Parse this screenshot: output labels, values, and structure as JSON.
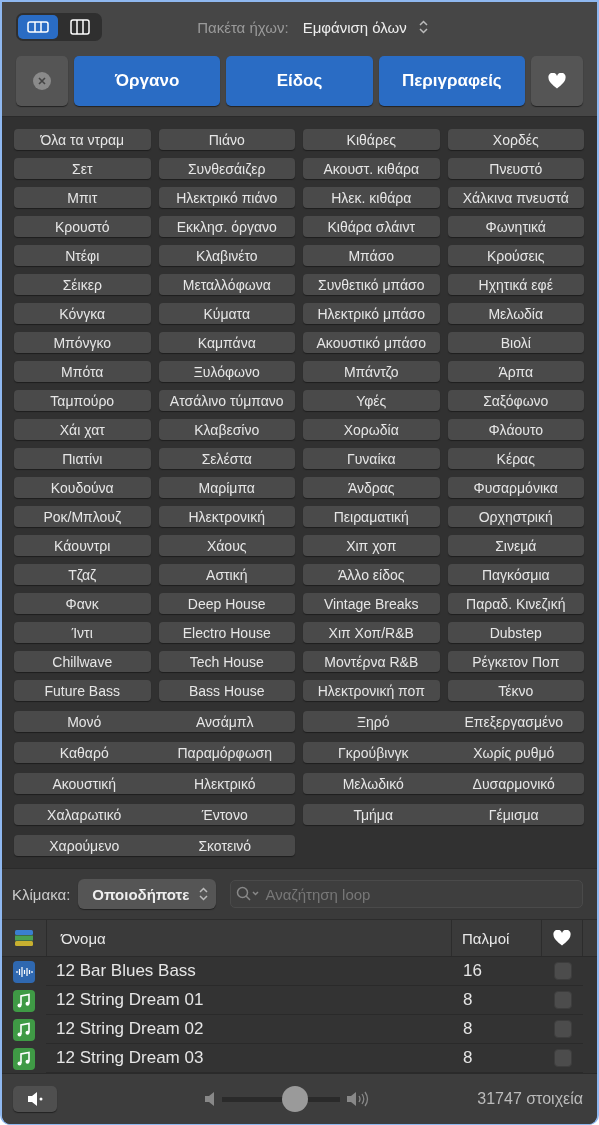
{
  "toolbar": {
    "view_modes": [
      {
        "kind": "rows",
        "selected": true
      },
      {
        "kind": "columns",
        "selected": false
      }
    ],
    "label": "Πακέτα ήχων:",
    "value": "Εμφάνιση όλων"
  },
  "categories": [
    {
      "label": "Όργανο",
      "selected": true
    },
    {
      "label": "Είδος",
      "selected": true
    },
    {
      "label": "Περιγραφείς",
      "selected": true
    }
  ],
  "keywords": [
    [
      {
        "label": "Όλα τα ντραμ",
        "selected": false
      },
      {
        "label": "Πιάνο",
        "selected": false
      },
      {
        "label": "Κιθάρες",
        "selected": false
      },
      {
        "label": "Χορδές",
        "selected": false
      }
    ],
    [
      {
        "label": "Σετ",
        "selected": false
      },
      {
        "label": "Συνθεσάιζερ",
        "selected": false
      },
      {
        "label": "Ακουστ. κιθάρα",
        "selected": false
      },
      {
        "label": "Πνευστό",
        "selected": false
      }
    ],
    [
      {
        "label": "Μπιτ",
        "selected": false
      },
      {
        "label": "Ηλεκτρικό πιάνο",
        "selected": false
      },
      {
        "label": "Ηλεκ. κιθάρα",
        "selected": false
      },
      {
        "label": "Χάλκινα πνευστά",
        "selected": false
      }
    ],
    [
      {
        "label": "Κρουστό",
        "selected": false
      },
      {
        "label": "Εκκλησ. όργανο",
        "selected": false
      },
      {
        "label": "Κιθάρα σλάιντ",
        "selected": false
      },
      {
        "label": "Φωνητικά",
        "selected": false
      }
    ],
    [
      {
        "label": "Ντέφι",
        "selected": false
      },
      {
        "label": "Κλαβινέτο",
        "selected": false
      },
      {
        "label": "Μπάσο",
        "selected": false
      },
      {
        "label": "Κρούσεις",
        "selected": false
      }
    ],
    [
      {
        "label": "Σέικερ",
        "selected": false
      },
      {
        "label": "Μεταλλόφωνα",
        "selected": false
      },
      {
        "label": "Συνθετικό μπάσο",
        "selected": false
      },
      {
        "label": "Ηχητικά εφέ",
        "selected": false
      }
    ],
    [
      {
        "label": "Κόνγκα",
        "selected": false
      },
      {
        "label": "Κύματα",
        "selected": false
      },
      {
        "label": "Ηλεκτρικό μπάσο",
        "selected": false
      },
      {
        "label": "Μελωδία",
        "selected": false
      }
    ],
    [
      {
        "label": "Μπόνγκο",
        "selected": false
      },
      {
        "label": "Καμπάνα",
        "selected": false
      },
      {
        "label": "Ακουστικό μπάσο",
        "selected": false
      },
      {
        "label": "Βιολί",
        "selected": false
      }
    ],
    [
      {
        "label": "Μπότα",
        "selected": false
      },
      {
        "label": "Ξυλόφωνο",
        "selected": false
      },
      {
        "label": "Μπάντζο",
        "selected": false
      },
      {
        "label": "Άρπα",
        "selected": false
      }
    ],
    [
      {
        "label": "Ταμπούρο",
        "selected": false
      },
      {
        "label": "Ατσάλινο τύμπανο",
        "selected": false
      },
      {
        "label": "Υφές",
        "selected": false
      },
      {
        "label": "Σαξόφωνο",
        "selected": false
      }
    ],
    [
      {
        "label": "Χάι χατ",
        "selected": false
      },
      {
        "label": "Κλαβεσίνο",
        "selected": false
      },
      {
        "label": "Χορωδία",
        "selected": false
      },
      {
        "label": "Φλάουτο",
        "selected": false
      }
    ],
    [
      {
        "label": "Πιατίνι",
        "selected": false
      },
      {
        "label": "Σελέστα",
        "selected": false
      },
      {
        "label": "Γυναίκα",
        "selected": false
      },
      {
        "label": "Κέρας",
        "selected": false
      }
    ],
    [
      {
        "label": "Κουδούνα",
        "selected": false
      },
      {
        "label": "Μαρίμπα",
        "selected": false
      },
      {
        "label": "Άνδρας",
        "selected": false
      },
      {
        "label": "Φυσαρμόνικα",
        "selected": false
      }
    ],
    [
      {
        "label": "Ροκ/Μπλουζ",
        "selected": false
      },
      {
        "label": "Ηλεκτρονική",
        "selected": false
      },
      {
        "label": "Πειραματική",
        "selected": false
      },
      {
        "label": "Ορχηστρική",
        "selected": false
      }
    ],
    [
      {
        "label": "Κάουντρι",
        "selected": false
      },
      {
        "label": "Χάους",
        "selected": false
      },
      {
        "label": "Χιπ χοπ",
        "selected": false
      },
      {
        "label": "Σινεμά",
        "selected": false
      }
    ],
    [
      {
        "label": "Τζαζ",
        "selected": false
      },
      {
        "label": "Αστική",
        "selected": false
      },
      {
        "label": "Άλλο είδος",
        "selected": false
      },
      {
        "label": "Παγκόσμια",
        "selected": false
      }
    ],
    [
      {
        "label": "Φανκ",
        "selected": false
      },
      {
        "label": "Deep House",
        "selected": false
      },
      {
        "label": "Vintage Breaks",
        "selected": false
      },
      {
        "label": "Παραδ. Κινεζική",
        "selected": false
      }
    ],
    [
      {
        "label": "Ίντι",
        "selected": false
      },
      {
        "label": "Electro House",
        "selected": false
      },
      {
        "label": "Χιπ Χοπ/R&B",
        "selected": false
      },
      {
        "label": "Dubstep",
        "selected": false
      }
    ],
    [
      {
        "label": "Chillwave",
        "selected": false
      },
      {
        "label": "Tech House",
        "selected": false
      },
      {
        "label": "Μοντέρνα R&B",
        "selected": false
      },
      {
        "label": "Ρέγκετον Ποπ",
        "selected": false
      }
    ],
    [
      {
        "label": "Future Bass",
        "selected": false
      },
      {
        "label": "Bass House",
        "selected": false
      },
      {
        "label": "Ηλεκτρονική ποπ",
        "selected": false
      },
      {
        "label": "Τέκνο",
        "selected": false
      }
    ]
  ],
  "descriptors": [
    [
      [
        {
          "label": "Μονό",
          "selected": false
        },
        {
          "label": "Ανσάμπλ",
          "selected": false
        }
      ],
      [
        {
          "label": "Ξηρό",
          "selected": false
        },
        {
          "label": "Επεξεργασμένο",
          "selected": false
        }
      ]
    ],
    [
      [
        {
          "label": "Καθαρό",
          "selected": false
        },
        {
          "label": "Παραμόρφωση",
          "selected": false
        }
      ],
      [
        {
          "label": "Γκρούβινγκ",
          "selected": false
        },
        {
          "label": "Χωρίς ρυθμό",
          "selected": false
        }
      ]
    ],
    [
      [
        {
          "label": "Ακουστική",
          "selected": false
        },
        {
          "label": "Ηλεκτρικό",
          "selected": false
        }
      ],
      [
        {
          "label": "Μελωδικό",
          "selected": false
        },
        {
          "label": "Δυσαρμονικό",
          "selected": false
        }
      ]
    ],
    [
      [
        {
          "label": "Χαλαρωτικό",
          "selected": false
        },
        {
          "label": "Έντονο",
          "selected": false
        }
      ],
      [
        {
          "label": "Τμήμα",
          "selected": false
        },
        {
          "label": "Γέμισμα",
          "selected": false
        }
      ]
    ],
    [
      [
        {
          "label": "Χαρούμενο",
          "selected": false
        },
        {
          "label": "Σκοτεινό",
          "selected": false
        }
      ]
    ]
  ],
  "scale": {
    "label": "Κλίμακα:",
    "value": "Οποιοδήποτε"
  },
  "search": {
    "placeholder": "Αναζήτηση loop"
  },
  "table": {
    "columns": [
      "Όνομα",
      "Παλμοί"
    ],
    "rows": [
      {
        "kind": "audio",
        "name": "12 Bar Blues Bass",
        "beats": "16",
        "favorite": false
      },
      {
        "kind": "midi",
        "name": "12 String Dream 01",
        "beats": "8",
        "favorite": false
      },
      {
        "kind": "midi",
        "name": "12 String Dream 02",
        "beats": "8",
        "favorite": false
      },
      {
        "kind": "midi",
        "name": "12 String Dream 03",
        "beats": "8",
        "favorite": false
      }
    ]
  },
  "footer": {
    "volume": {
      "level": 0.62
    },
    "count": "31747 στοιχεία"
  }
}
